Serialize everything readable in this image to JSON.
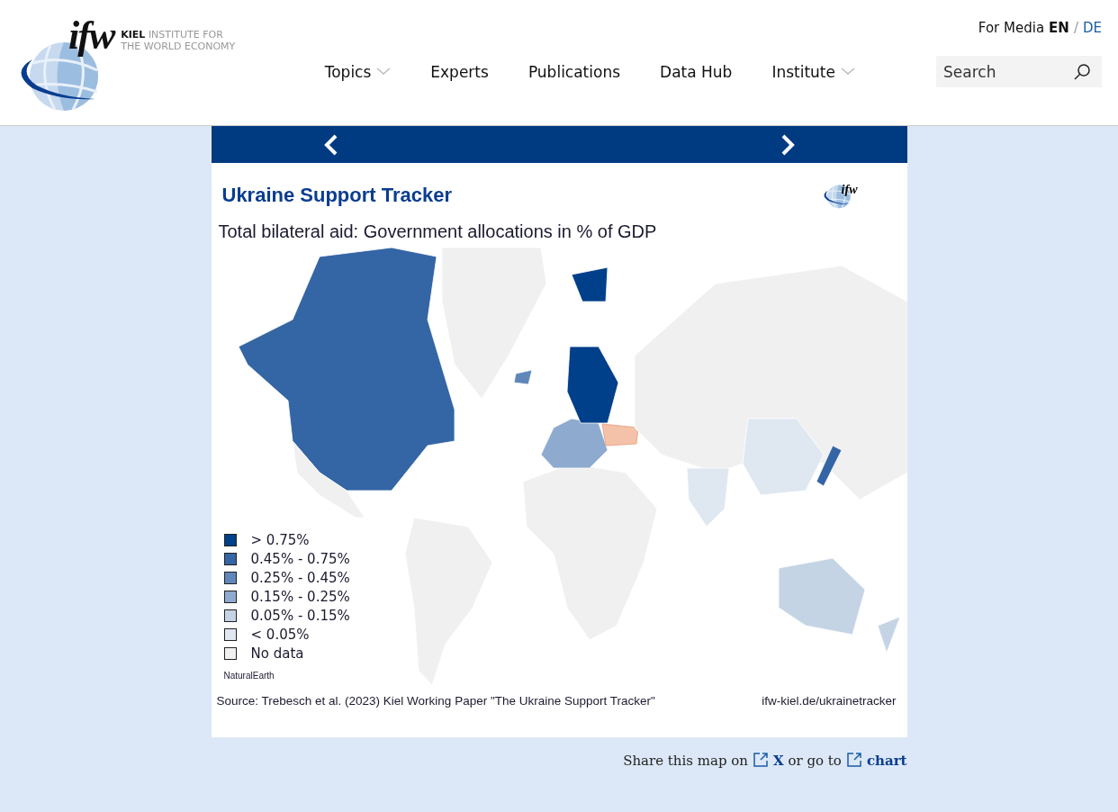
{
  "header": {
    "logo": {
      "mark": "ifw",
      "line1_bold": "KIEL",
      "line1_rest": "INSTITUTE FOR",
      "line2": "THE WORLD ECONOMY"
    },
    "top_link": "For Media",
    "languages": [
      {
        "label": "EN",
        "selected": true
      },
      {
        "label": "DE",
        "selected": false
      }
    ],
    "language_separator": "/",
    "nav": [
      {
        "label": "Topics",
        "has_dropdown": true
      },
      {
        "label": "Experts",
        "has_dropdown": false
      },
      {
        "label": "Publications",
        "has_dropdown": false
      },
      {
        "label": "Data Hub",
        "has_dropdown": false
      },
      {
        "label": "Institute",
        "has_dropdown": true
      }
    ],
    "search": {
      "placeholder": "Search"
    }
  },
  "slide": {
    "title": "Ukraine Support Tracker",
    "logo_mark": "ifw",
    "subtitle": "Total bilateral aid: Government allocations in % of GDP",
    "legend": [
      {
        "label": "> 0.75%",
        "color": "#003f8a"
      },
      {
        "label": "0.45% - 0.75%",
        "color": "#3465a4"
      },
      {
        "label": "0.25% - 0.45%",
        "color": "#5f87ba"
      },
      {
        "label": "0.15% - 0.25%",
        "color": "#8eaacf"
      },
      {
        "label": "0.05% - 0.15%",
        "color": "#c5d4e5"
      },
      {
        "label": "< 0.05%",
        "color": "#dfe7f1"
      },
      {
        "label": "No data",
        "color": "#f0f0f0"
      }
    ],
    "credit": "NaturalEarth",
    "source": "Source: Trebesch et al. (2023) Kiel Working Paper \"The Ukraine Support Tracker\"",
    "url": "ifw-kiel.de/ukrainetracker"
  },
  "share": {
    "prefix": "Share this map on",
    "link1": "X",
    "middle": "or go to",
    "link2": "chart"
  }
}
